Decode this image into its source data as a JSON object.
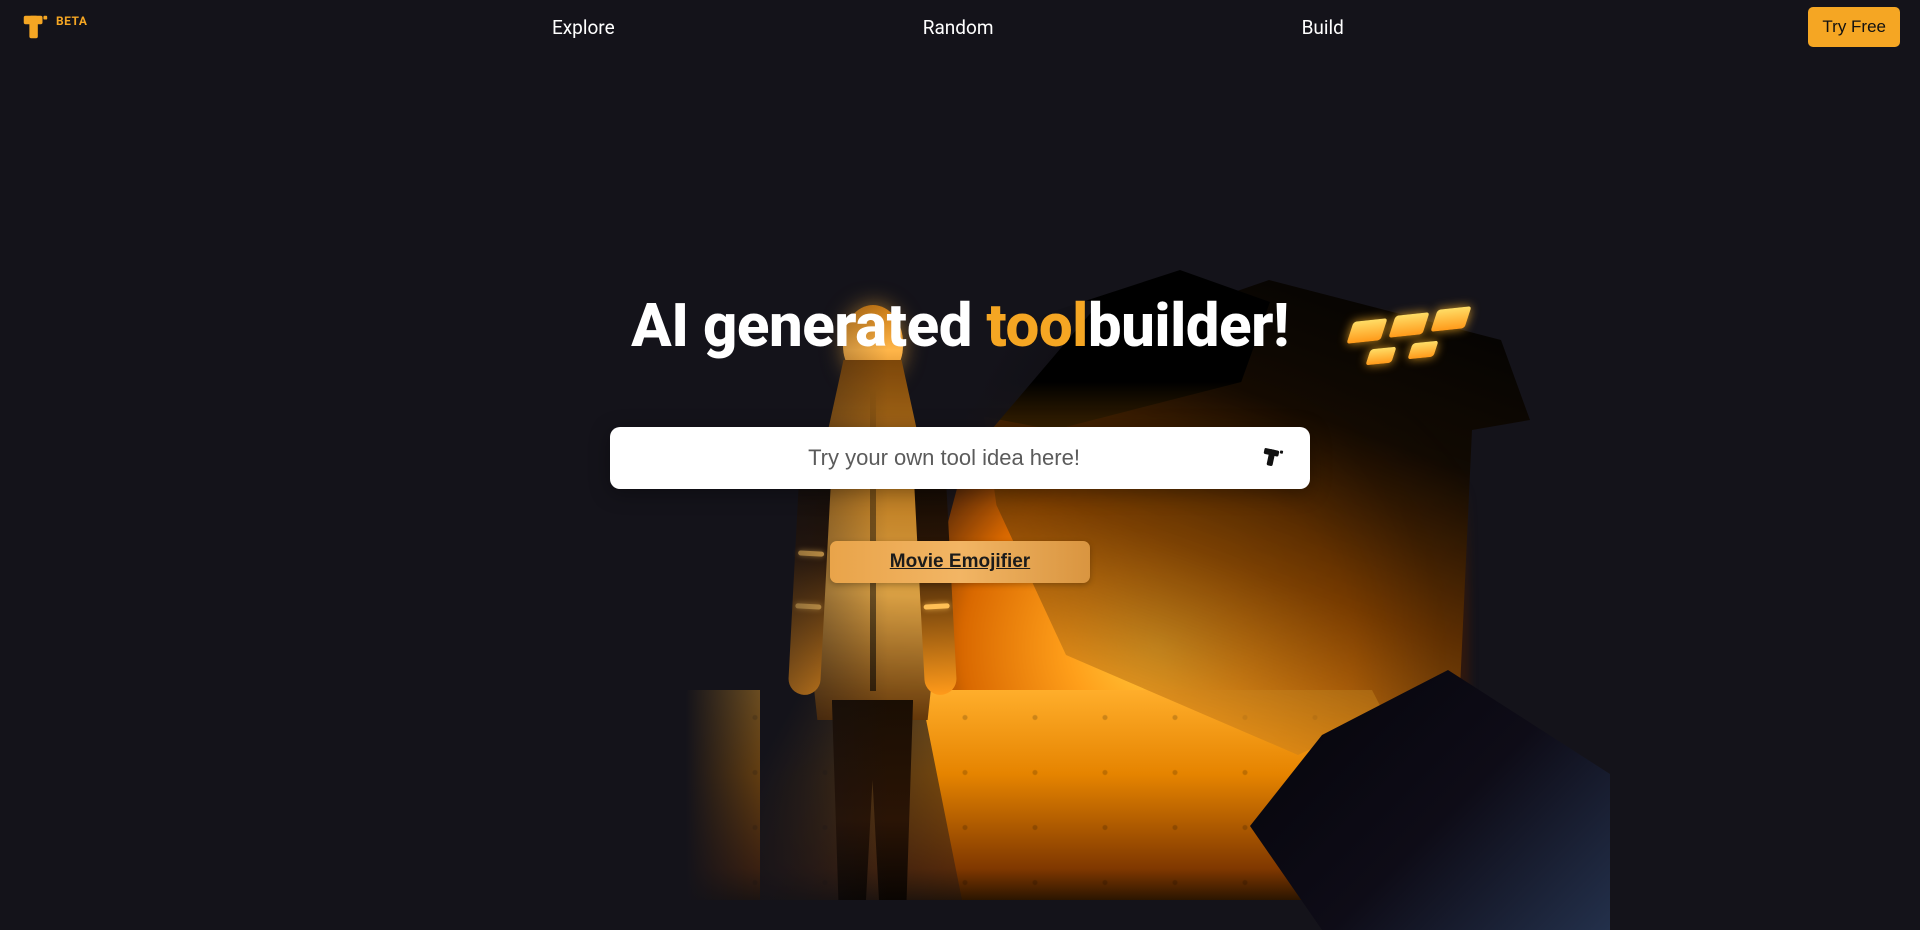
{
  "header": {
    "beta_label": "BETA",
    "nav": {
      "explore": "Explore",
      "random": "Random",
      "build": "Build"
    },
    "try_free": "Try Free"
  },
  "hero": {
    "headline_prefix": "AI generated ",
    "headline_accent": "tool",
    "headline_suffix": "builder!",
    "input_placeholder": "Try your own tool idea here!",
    "suggestion": "Movie Emojifier"
  }
}
